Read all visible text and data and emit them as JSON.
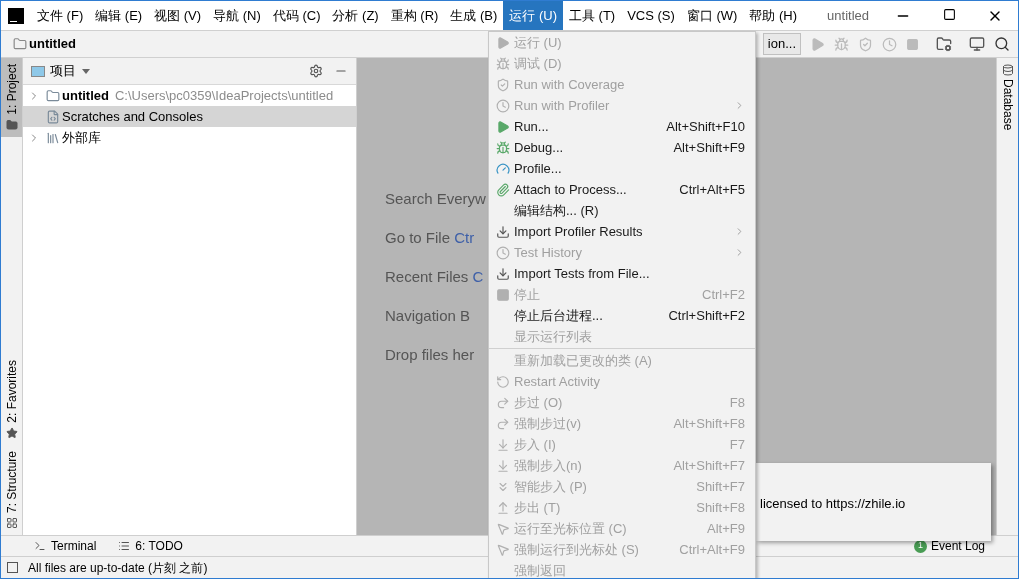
{
  "menubar": [
    {
      "label": "文件 (F)",
      "selected": false
    },
    {
      "label": "编辑 (E)",
      "selected": false
    },
    {
      "label": "视图 (V)",
      "selected": false
    },
    {
      "label": "导航 (N)",
      "selected": false
    },
    {
      "label": "代码 (C)",
      "selected": false
    },
    {
      "label": "分析 (Z)",
      "selected": false
    },
    {
      "label": "重构 (R)",
      "selected": false
    },
    {
      "label": "生成 (B)",
      "selected": false
    },
    {
      "label": "运行 (U)",
      "selected": true
    },
    {
      "label": "工具 (T)",
      "selected": false
    },
    {
      "label": "VCS (S)",
      "selected": false
    },
    {
      "label": "窗口 (W)",
      "selected": false
    },
    {
      "label": "帮助 (H)",
      "selected": false
    }
  ],
  "window": {
    "title": "untitled"
  },
  "toolbar": {
    "breadcrumb": "untitled",
    "config_button": "ion..."
  },
  "left_stripe": [
    {
      "label": "1: Project",
      "selected": true,
      "kind": "folder"
    },
    {
      "label": "2: Favorites",
      "selected": false,
      "kind": "star"
    },
    {
      "label": "7: Structure",
      "selected": false,
      "kind": "structure"
    }
  ],
  "project_panel": {
    "title": "项目",
    "items": [
      {
        "name": "untitled",
        "path": "C:\\Users\\pc0359\\IdeaProjects\\untitled",
        "kind": "module",
        "expanded": false,
        "selected": false
      },
      {
        "name": "Scratches and Consoles",
        "kind": "scratch",
        "selected": true
      },
      {
        "name": "外部库",
        "kind": "library",
        "expanded": false,
        "selected": false
      }
    ]
  },
  "editor": {
    "hints": [
      {
        "text": "Search Everyw"
      },
      {
        "text": "Go to File ",
        "shortcut": "Ctr"
      },
      {
        "text": "Recent Files ",
        "shortcut": "C"
      },
      {
        "text": "Navigation B"
      },
      {
        "text": "Drop files her"
      }
    ]
  },
  "notification": {
    "text": "licensed to https://zhile.io"
  },
  "right_stripe": [
    {
      "label": "Database",
      "selected": false
    }
  ],
  "run_menu": [
    {
      "label": "运行 (U)",
      "disabled": true,
      "kind": "play"
    },
    {
      "label": "调试 (D)",
      "disabled": true,
      "kind": "bug"
    },
    {
      "label": "Run with Coverage",
      "disabled": true,
      "kind": "coverage"
    },
    {
      "label": "Run with Profiler",
      "disabled": true,
      "kind": "profiler",
      "submenu": true
    },
    {
      "label": "Run...",
      "shortcut": "Alt+Shift+F10",
      "disabled": false,
      "kind": "play"
    },
    {
      "label": "Debug...",
      "shortcut": "Alt+Shift+F9",
      "disabled": false,
      "kind": "bug"
    },
    {
      "label": "Profile...",
      "disabled": false,
      "kind": "gauge"
    },
    {
      "label": "Attach to Process...",
      "shortcut": "Ctrl+Alt+F5",
      "disabled": false,
      "kind": "attach"
    },
    {
      "label": "编辑结构... (R)",
      "disabled": false
    },
    {
      "label": "Import Profiler Results",
      "disabled": false,
      "kind": "import",
      "submenu": true
    },
    {
      "label": "Test History",
      "disabled": true,
      "kind": "history",
      "submenu": true
    },
    {
      "label": "Import Tests from File...",
      "disabled": false,
      "kind": "import"
    },
    {
      "label": "停止",
      "shortcut": "Ctrl+F2",
      "disabled": true,
      "kind": "stop"
    },
    {
      "label": "停止后台进程...",
      "shortcut": "Ctrl+Shift+F2",
      "disabled": false
    },
    {
      "label": "显示运行列表",
      "disabled": true,
      "separator_after": true
    },
    {
      "label": "重新加载已更改的类 (A)",
      "disabled": true
    },
    {
      "label": "Restart Activity",
      "disabled": true,
      "kind": "restart"
    },
    {
      "label": "步过 (O)",
      "shortcut": "F8",
      "disabled": true,
      "kind": "step-over"
    },
    {
      "label": "强制步过(v)",
      "shortcut": "Alt+Shift+F8",
      "disabled": true,
      "kind": "step-over"
    },
    {
      "label": "步入 (I)",
      "shortcut": "F7",
      "disabled": true,
      "kind": "step-into"
    },
    {
      "label": "强制步入(n)",
      "shortcut": "Alt+Shift+F7",
      "disabled": true,
      "kind": "step-into"
    },
    {
      "label": "智能步入 (P)",
      "shortcut": "Shift+F7",
      "disabled": true,
      "kind": "smart-step"
    },
    {
      "label": "步出 (T)",
      "shortcut": "Shift+F8",
      "disabled": true,
      "kind": "step-out"
    },
    {
      "label": "运行至光标位置 (C)",
      "shortcut": "Alt+F9",
      "disabled": true,
      "kind": "cursor"
    },
    {
      "label": "强制运行到光标处 (S)",
      "shortcut": "Ctrl+Alt+F9",
      "disabled": true,
      "kind": "cursor"
    },
    {
      "label": "强制返回",
      "disabled": true
    }
  ],
  "tool_windows": [
    {
      "label": "Terminal",
      "kind": "terminal"
    },
    {
      "label": "6: TODO",
      "kind": "list"
    }
  ],
  "event_log": {
    "count": "1",
    "label": "Event Log"
  },
  "status_bar": {
    "text": "All files are up-to-date (片刻 之前)"
  }
}
